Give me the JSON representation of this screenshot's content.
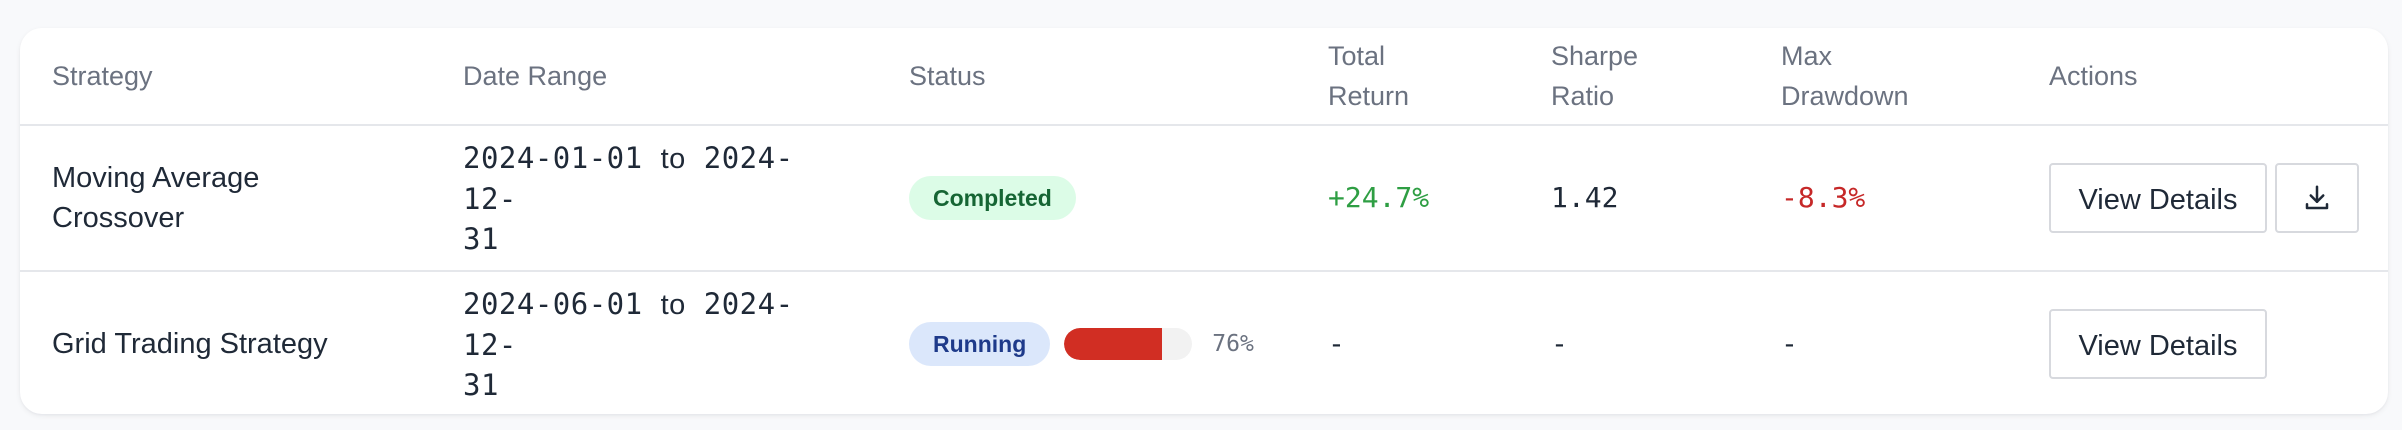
{
  "table": {
    "headers": {
      "strategy": "Strategy",
      "date_range": "Date Range",
      "status": "Status",
      "total_return_1": "Total",
      "total_return_2": "Return",
      "sharpe_1": "Sharpe",
      "sharpe_2": "Ratio",
      "drawdown_1": "Max",
      "drawdown_2": "Drawdown",
      "actions": "Actions"
    },
    "rows": [
      {
        "strategy_1": "Moving Average",
        "strategy_2": "Crossover",
        "date_start": "2024-01-01",
        "date_to": "to",
        "date_end_1": "2024-12-",
        "date_end_2": "31",
        "status": "Completed",
        "total_return": "+24.7%",
        "sharpe": "1.42",
        "drawdown": "-8.3%",
        "view_label": "View Details"
      },
      {
        "strategy_1": "Grid Trading Strategy",
        "date_start": "2024-06-01",
        "date_to": "to",
        "date_end_1": "2024-12-",
        "date_end_2": "31",
        "status": "Running",
        "progress": 0.76,
        "progress_label": "76%",
        "total_return": "-",
        "sharpe": "-",
        "drawdown": "-",
        "view_label": "View Details"
      }
    ]
  },
  "colors": {
    "positive": "#2e9e43",
    "negative": "#c62828",
    "completed_bg": "#dcfce7",
    "running_bg": "#dbe7fb",
    "progress_fill": "#d12e23"
  },
  "icons": {
    "download": "download-icon"
  }
}
